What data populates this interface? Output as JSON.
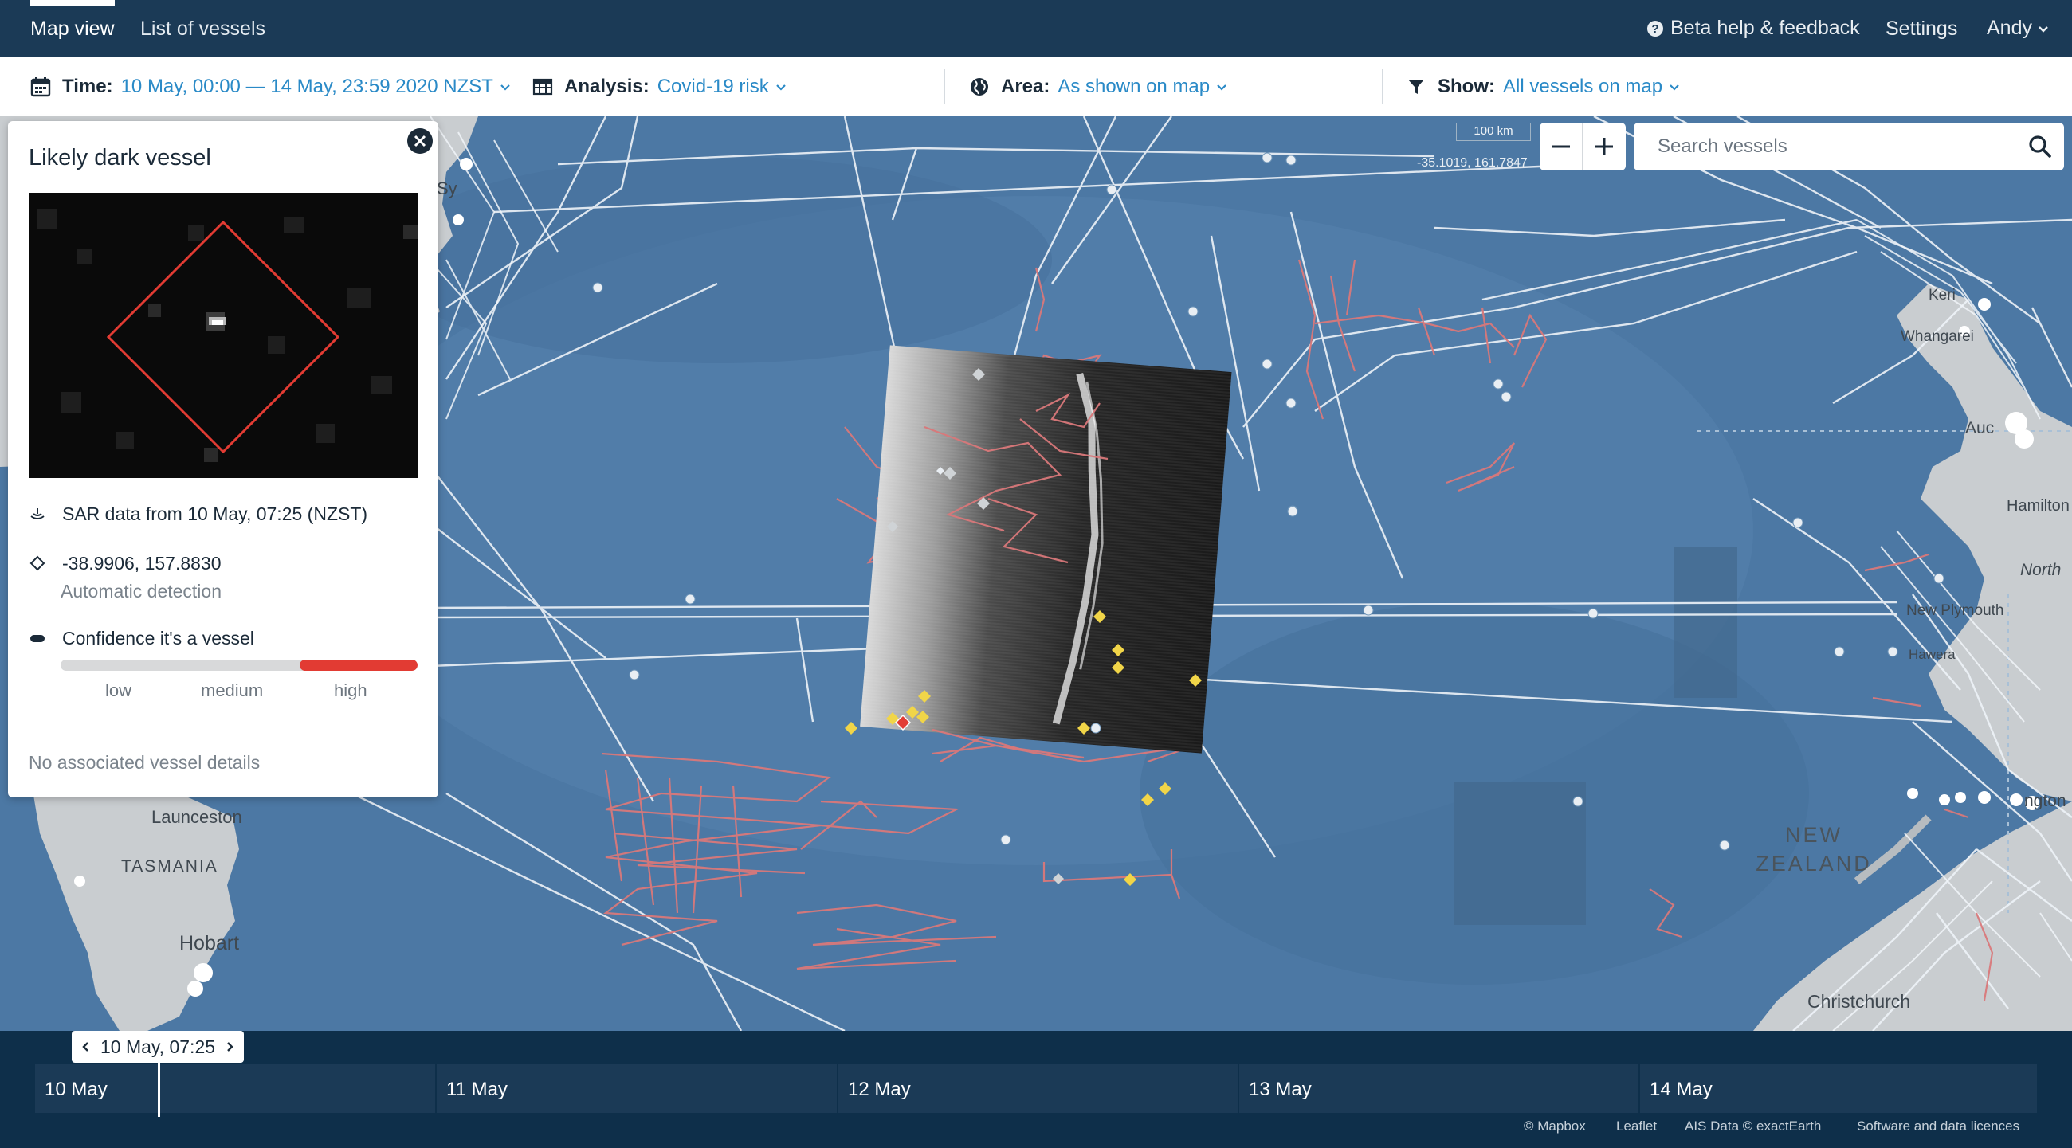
{
  "nav": {
    "tabs": [
      {
        "label": "Map view",
        "active": true
      },
      {
        "label": "List of vessels",
        "active": false
      }
    ],
    "help_label": "Beta help & feedback",
    "settings_label": "Settings",
    "user_label": "Andy"
  },
  "filters": {
    "time": {
      "label": "Time:",
      "value": "10 May, 00:00 — 14 May, 23:59 2020 NZST"
    },
    "analysis": {
      "label": "Analysis:",
      "value": "Covid-19 risk"
    },
    "area": {
      "label": "Area:",
      "value": "As shown on map"
    },
    "show": {
      "label": "Show:",
      "value": "All vessels on map"
    }
  },
  "map": {
    "scale_label": "100 km",
    "coordinate_readout": "-35.1019, 161.7847",
    "search": {
      "placeholder": "Search vessels",
      "value": ""
    },
    "labels": {
      "tasmania": "TASMANIA",
      "launceston": "Launceston",
      "hobart": "Hobart",
      "sydney": "Sy",
      "new_zealand": "NEW ZEALAND",
      "kerikeri": "Keri",
      "whangarei": "Whangarei",
      "auckland": "Auc",
      "hamilton": "Hamilton",
      "north": "North",
      "new_plymouth": "New Plymouth",
      "hawera": "Hawera",
      "wellington": "ngton",
      "christchurch": "Christchurch"
    },
    "colors": {
      "ocean": "#4c78a4",
      "land": "#c9cdd0",
      "track": "#eef3f8",
      "fishing_track": "#d9787a",
      "detection": "#f1d548",
      "dark_vessel": "#e23b33"
    }
  },
  "panel": {
    "title": "Likely dark vessel",
    "sar_text": "SAR data from 10 May, 07:25 (NZST)",
    "coords": "-38.9906, 157.8830",
    "detection_type": "Automatic detection",
    "confidence_label": "Confidence it's a vessel",
    "confidence_level": "high",
    "confidence_fraction": 0.33,
    "scale_labels": [
      "low",
      "medium",
      "high"
    ],
    "no_details": "No associated vessel details"
  },
  "timeline": {
    "current": "10 May, 07:25",
    "days": [
      "10 May",
      "11 May",
      "12 May",
      "13 May",
      "14 May"
    ],
    "credits": [
      "© Mapbox",
      "Leaflet",
      "AIS Data © exactEarth",
      "Software and data licences"
    ]
  }
}
